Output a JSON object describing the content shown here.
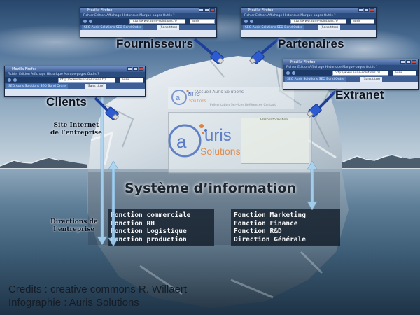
{
  "browser": {
    "window_title": "Mozilla Firefox",
    "menu": "Fichier  Edition  Affichage  Historique  Marque-pages  Outils  ?",
    "url": "http://www.auris-solutions.fr/",
    "search": "auris",
    "tab_left": "SEO Auris Solutions  SEO Bond Ordre",
    "tab_right": "(Sans titre)"
  },
  "labels": {
    "fournisseurs": "Fournisseurs",
    "partenaires": "Partenaires",
    "clients": "Clients",
    "extranet": "Extranet",
    "site_line1": "Site Internet",
    "site_line2": "de l’entreprise",
    "directions_line1": "Directions de",
    "directions_line2": "l’entreprise"
  },
  "website": {
    "logo_text": "uris",
    "logo_sub": "Solutions",
    "title_blurred": "Accueil  Auris Solutions",
    "subtitle_blurred": "Présentation  Services  Références  Contact",
    "box_title": "Flash Information"
  },
  "system": {
    "title": "Système d’information",
    "functions_left": [
      "Fonction commerciale",
      "Fonction RH",
      "Fonction Logistique",
      "Fonction production"
    ],
    "functions_right": [
      "Fonction Marketing",
      "Fonction Finance",
      "Fonction R&D",
      "Direction Générale"
    ]
  },
  "credits": {
    "line1": "Credits : creative commons R. Willaert",
    "line2": "Infographie : Auris Solutions"
  },
  "colors": {
    "arrow": "#a9d4f2",
    "cable": "#2d5bd1",
    "logo_blue": "#4a6fc2",
    "logo_orange": "#e0803a",
    "function_box": "#121c28"
  }
}
